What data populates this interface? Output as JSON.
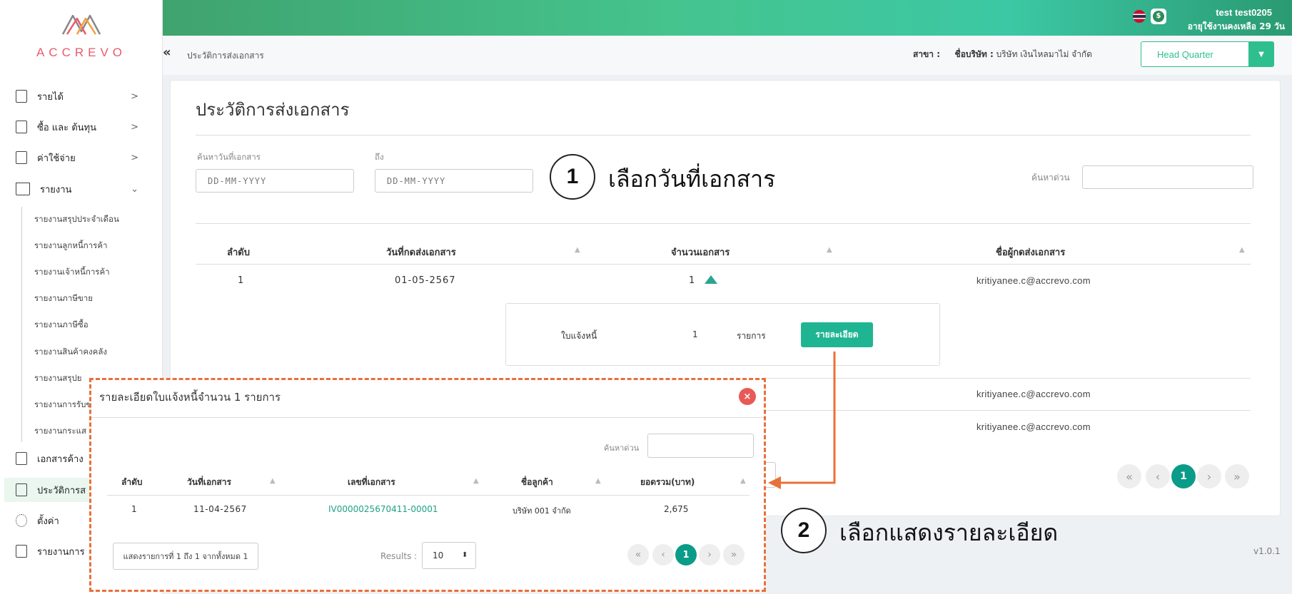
{
  "app": {
    "logo_text": "ACCREVO",
    "version": "v1.0.1"
  },
  "user": {
    "name": "test test0205",
    "subscription": "อายุใช้งานคงเหลือ 29 วัน"
  },
  "header": {
    "breadcrumb": "ประวัติการส่งเอกสาร",
    "company_label": "ชื่อบริษัท :",
    "company_value": "บริษัท เงินไหลมาไม่ จำกัด",
    "branch_label": "สาขา :",
    "branch_value": "Head Quarter"
  },
  "sidebar": {
    "items": [
      {
        "label": "รายได้"
      },
      {
        "label": "ซื้อ และ ต้นทุน"
      },
      {
        "label": "ค่าใช้จ่าย"
      },
      {
        "label": "รายงาน"
      }
    ],
    "sub_items": [
      "รายงานสรุปประจำเดือน",
      "รายงานลูกหนี้การค้า",
      "รายงานเจ้าหนี้การค้า",
      "รายงานภาษีขาย",
      "รายงานภาษีซื้อ",
      "รายงานสินค้าคงคลัง",
      "รายงานสรุปย",
      "รายงานการรับข",
      "รายงานกระแส"
    ],
    "bottom_items": [
      {
        "label": "เอกสารค้าง"
      },
      {
        "label": "ประวัติการส"
      },
      {
        "label": "ตั้งค่า"
      },
      {
        "label": "รายงานการ"
      }
    ]
  },
  "main": {
    "title": "ประวัติการส่งเอกสาร",
    "filter": {
      "from_label": "ค้นหาวันที่เอกสาร",
      "to_label": "ถึง",
      "from_placeholder": "DD-MM-YYYY",
      "to_placeholder": "DD-MM-YYYY",
      "quick_search_label": "ค้นหาด่วน"
    },
    "table": {
      "headers": [
        "ลำดับ",
        "วันที่กดส่งเอกสาร",
        "จำนวนเอกสาร",
        "ชื่อผู้กดส่งเอกสาร"
      ],
      "row1": {
        "no": "1",
        "date": "01-05-2567",
        "count": "1",
        "sender": "kritiyanee.c@accrevo.com"
      },
      "row2_sender": "kritiyanee.c@accrevo.com",
      "row3_sender": "kritiyanee.c@accrevo.com"
    },
    "detail": {
      "doc_type": "ใบแจ้งหนี้",
      "count": "1",
      "unit": "รายการ",
      "button": "รายละเอียด"
    },
    "pagination": {
      "current": "1"
    }
  },
  "annotations": {
    "step1_num": "1",
    "step1_text": "เลือกวันที่เอกสาร",
    "step2_num": "2",
    "step2_text": "เลือกแสดงรายละเอียด"
  },
  "modal": {
    "title": "รายละเอียดใบแจ้งหนี้จำนวน 1 รายการ",
    "close": "×",
    "search_label": "ค้นหาด่วน",
    "headers": [
      "ลำดับ",
      "วันที่เอกสาร",
      "เลขที่เอกสาร",
      "ชื่อลูกค้า",
      "ยอดรวม(บาท)"
    ],
    "row": {
      "no": "1",
      "date": "11-04-2567",
      "doc_no": "IV0000025670411-00001",
      "customer": "บริษัท 001 จำกัด",
      "total": "2,675"
    },
    "info": "แสดงรายการที่ 1 ถึง 1 จากทั้งหมด 1",
    "results_label": "Results :",
    "results_value": "10",
    "current_page": "1"
  },
  "colors": {
    "accent": "#20b592",
    "annotation": "#e8703a",
    "close": "#e85a55"
  }
}
